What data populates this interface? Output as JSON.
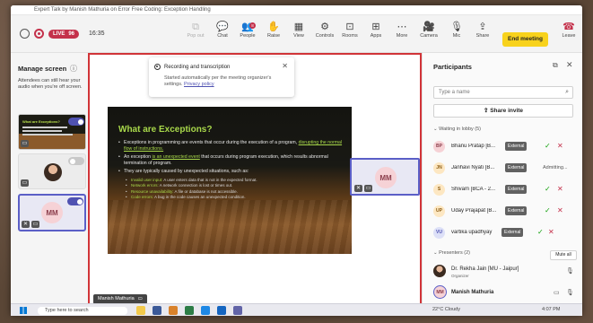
{
  "window": {
    "title": "Expert Talk by Manish Mathuria on Error Free Coding: Exception Handling"
  },
  "toolbar": {
    "live_label": "LIVE",
    "live_count": "96",
    "timer": "16:35",
    "buttons": [
      {
        "label": "Pop out",
        "icon": "pop-out-icon",
        "glyph": "⧉",
        "disabled": true
      },
      {
        "label": "Chat",
        "icon": "chat-icon",
        "glyph": "💬",
        "disabled": false
      },
      {
        "label": "People",
        "icon": "people-icon",
        "glyph": "👥",
        "disabled": false,
        "badge": "8"
      },
      {
        "label": "Raise",
        "icon": "raise-hand-icon",
        "glyph": "✋",
        "disabled": false
      },
      {
        "label": "View",
        "icon": "view-icon",
        "glyph": "▦",
        "disabled": false
      },
      {
        "label": "Controls",
        "icon": "controls-icon",
        "glyph": "⚙",
        "disabled": false
      },
      {
        "label": "Rooms",
        "icon": "rooms-icon",
        "glyph": "⊡",
        "disabled": false
      },
      {
        "label": "Apps",
        "icon": "apps-icon",
        "glyph": "⊞",
        "disabled": false
      },
      {
        "label": "More",
        "icon": "more-icon",
        "glyph": "⋯",
        "disabled": false
      },
      {
        "label": "Camera",
        "icon": "camera-icon",
        "glyph": "🎥",
        "disabled": false
      },
      {
        "label": "Mic",
        "icon": "mic-off-icon",
        "glyph": "🎙",
        "disabled": false
      },
      {
        "label": "Share",
        "icon": "share-icon",
        "glyph": "⇪",
        "disabled": false
      }
    ],
    "end_meeting": "End meeting",
    "leave": "Leave"
  },
  "left_panel": {
    "title": "Manage screen",
    "description": "Attendees can still hear your audio when you're off screen.",
    "thumb_slide_title": "What are Exceptions?",
    "thumb3_initials": "MM"
  },
  "toast": {
    "title": "Recording and transcription",
    "body": "Started automatically per the meeting organizer's settings.",
    "link": "Privacy policy"
  },
  "slide": {
    "title": "What are Exceptions?",
    "bullet1_pre": "Exceptions in programming are events that occur during the execution of a program, ",
    "bullet1_hl": "disrupting the normal flow of instructions.",
    "bullet2_pre": "An exception ",
    "bullet2_hl": "is an unexpected event",
    "bullet2_post": " that occurs during program execution, which results abnormal termination of program.",
    "bullet3": "They are typically caused by unexpected situations, such as:",
    "subs": [
      {
        "hl": "Invalid user input:",
        "text": " A user enters data that is not in the expected format."
      },
      {
        "hl": "Network errors:",
        "text": " A network connection is lost or times out."
      },
      {
        "hl": "Resource unavailability:",
        "text": " A file or database is not accessible."
      },
      {
        "hl": "Code errors:",
        "text": " A bug in the code causes an unexpected condition."
      }
    ]
  },
  "stage": {
    "presenter_name": "Manish Mathuria",
    "side_tile_initials": "MM"
  },
  "participants": {
    "title": "Participants",
    "search_placeholder": "Type a name",
    "share_invite": "Share invite",
    "lobby_header": "Waiting in lobby (5)",
    "lobby": [
      {
        "initials": "BP",
        "name": "Bhanu Pratap [B...",
        "badge": "External",
        "bg": "#f6d2d6",
        "fg": "#8a3c4a",
        "admitting": ""
      },
      {
        "initials": "JN",
        "name": "Janhavi Nyati [B...",
        "badge": "External",
        "bg": "#fde7c2",
        "fg": "#8a5a10",
        "admitting": "Admitting..."
      },
      {
        "initials": "S",
        "name": "Shivam [BCA - 2...",
        "badge": "External",
        "bg": "#fde7c2",
        "fg": "#8a5a10",
        "admitting": ""
      },
      {
        "initials": "UP",
        "name": "Uday Prajapat [B...",
        "badge": "External",
        "bg": "#fde7c2",
        "fg": "#8a5a10",
        "admitting": ""
      },
      {
        "initials": "VU",
        "name": "vartika upadhyay",
        "badge": "External",
        "bg": "#dde0f7",
        "fg": "#4f52b2",
        "admitting": ""
      }
    ],
    "presenters_header": "Presenters (2)",
    "mute_all": "Mute all",
    "presenters": [
      {
        "name": "Dr. Rekha Jain [MU - Jaipur]",
        "role": "Organizer",
        "initials": ""
      },
      {
        "name": "Manish Mathuria",
        "role": "",
        "initials": "MM"
      }
    ]
  },
  "taskbar": {
    "search_placeholder": "Type here to search",
    "weather": "22°C Cloudy",
    "time": "4:07 PM"
  },
  "colors": {
    "accent": "#5b5fc7",
    "live_red": "#c4314b",
    "end_meeting_yellow": "#f8d21c",
    "stage_border": "#d13438",
    "slide_title_green": "#a8d84a"
  }
}
